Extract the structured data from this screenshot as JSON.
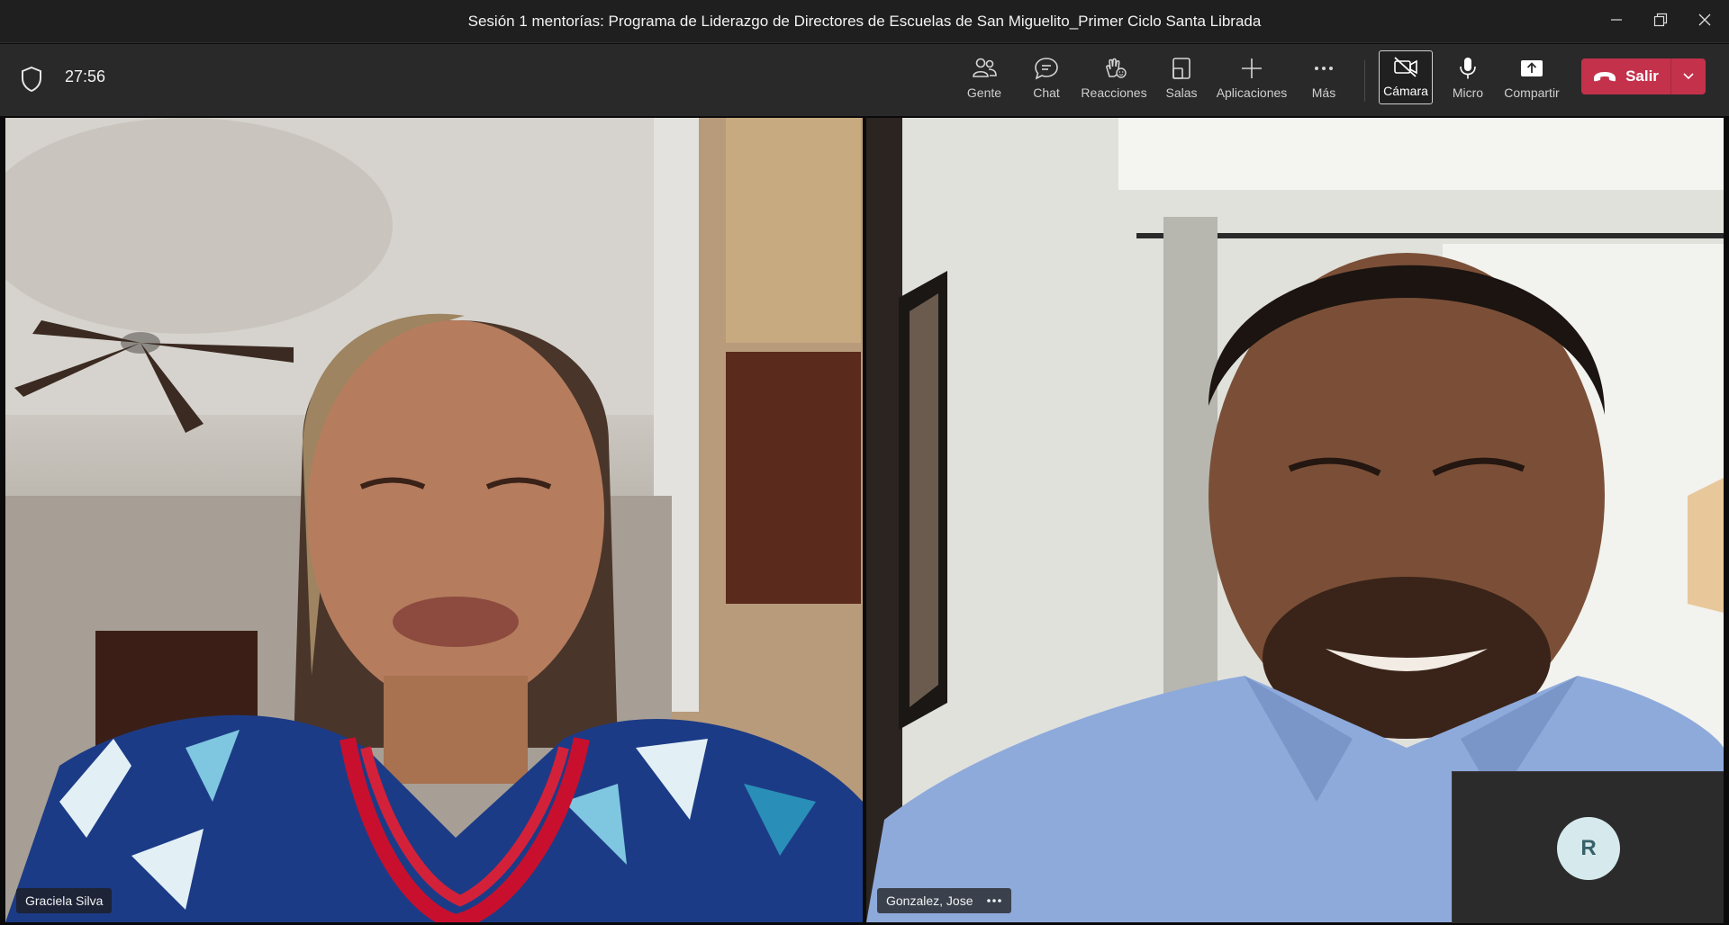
{
  "window": {
    "title": "Sesión 1 mentorías: Programa de Liderazgo de Directores de Escuelas de San Miguelito_Primer Ciclo Santa Librada"
  },
  "toolbar": {
    "timer": "27:56",
    "buttons": [
      {
        "label": "Gente",
        "icon": "people-icon"
      },
      {
        "label": "Chat",
        "icon": "chat-icon"
      },
      {
        "label": "Reacciones",
        "icon": "reactions-icon"
      },
      {
        "label": "Salas",
        "icon": "rooms-icon"
      },
      {
        "label": "Aplicaciones",
        "icon": "plus-icon"
      },
      {
        "label": "Más",
        "icon": "more-icon"
      },
      {
        "label": "Cámara",
        "icon": "camera-off-icon"
      },
      {
        "label": "Micro",
        "icon": "mic-icon"
      },
      {
        "label": "Compartir",
        "icon": "share-icon"
      }
    ],
    "leave_label": "Salir"
  },
  "participants": [
    {
      "name": "Graciela Silva"
    },
    {
      "name": "Gonzalez, Jose"
    }
  ],
  "self_view": {
    "initial": "R"
  },
  "colors": {
    "leave_button": "#c4314b",
    "toolbar_bg": "#292929",
    "titlebar_bg": "#1f1f1f"
  }
}
